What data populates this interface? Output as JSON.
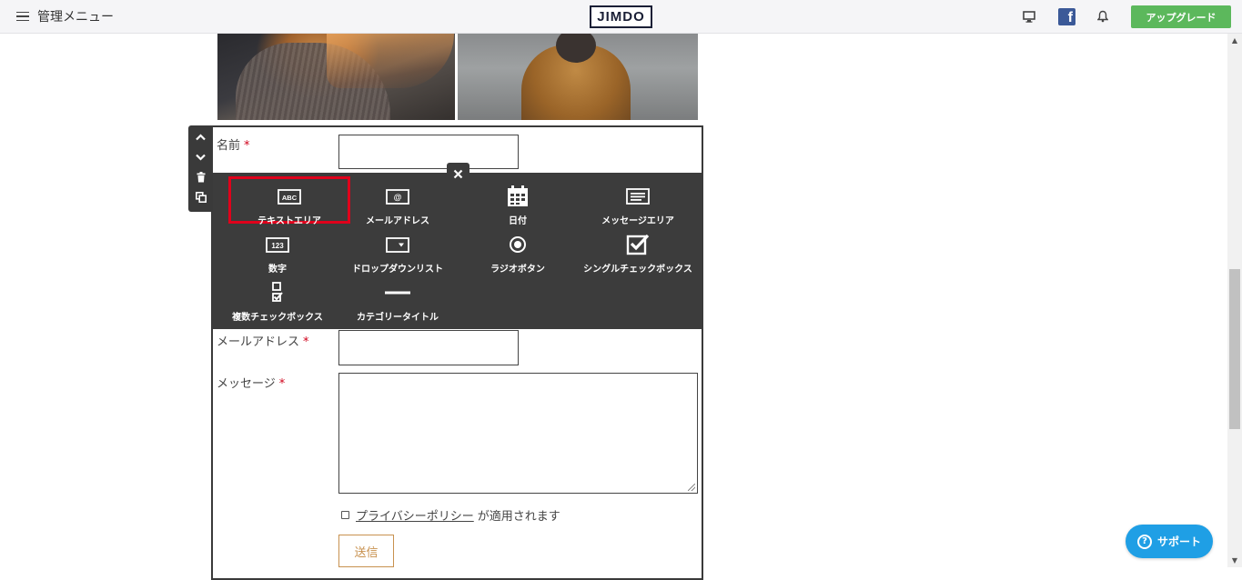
{
  "topbar": {
    "menu_label": "管理メニュー",
    "logo": "JIMDO",
    "upgrade_label": "アップグレード",
    "facebook_glyph": "f",
    "icons": [
      "monitor-icon",
      "facebook-icon",
      "bell-icon"
    ]
  },
  "form": {
    "name_label": "名前",
    "email_label": "メールアドレス",
    "message_label": "メッセージ",
    "required_mark": "*",
    "privacy_link": "プライバシーポリシー",
    "privacy_suffix": "が適用されます",
    "submit_label": "送信"
  },
  "picker": {
    "close_glyph": "✕",
    "selected": "テキストエリア",
    "types": [
      {
        "label": "テキストエリア",
        "icon": "abc-text-icon"
      },
      {
        "label": "メールアドレス",
        "icon": "at-email-icon"
      },
      {
        "label": "日付",
        "icon": "calendar-icon"
      },
      {
        "label": "メッセージエリア",
        "icon": "message-area-icon"
      },
      {
        "label": "数字",
        "icon": "number-123-icon"
      },
      {
        "label": "ドロップダウンリスト",
        "icon": "dropdown-icon"
      },
      {
        "label": "ラジオボタン",
        "icon": "radio-icon"
      },
      {
        "label": "シングルチェックボックス",
        "icon": "checkbox-checked-icon"
      },
      {
        "label": "複数チェックボックス",
        "icon": "multi-checkbox-icon"
      },
      {
        "label": "カテゴリータイトル",
        "icon": "category-line-icon"
      }
    ]
  },
  "side_tools": [
    "move-up-icon",
    "move-down-icon",
    "trash-icon",
    "copy-icon"
  ],
  "support": {
    "label": "サポート",
    "glyph": "?"
  },
  "colors": {
    "upgrade": "#5cb85c",
    "support": "#1f9fe5",
    "picker_bg": "#3c3c3c",
    "selected_outline": "#e0001b",
    "submit": "#c8914f",
    "required": "#d0021b"
  }
}
